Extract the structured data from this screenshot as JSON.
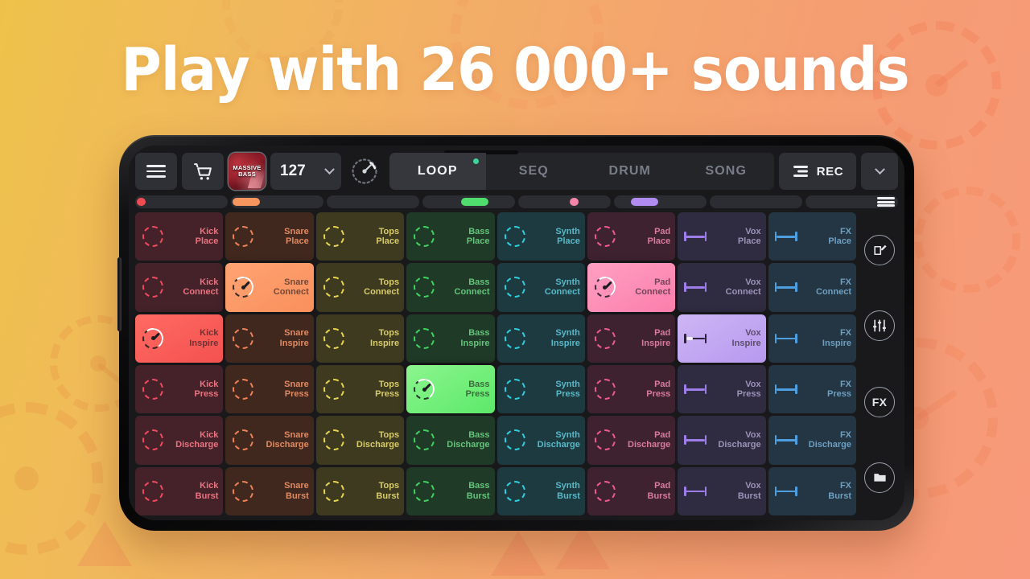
{
  "headline": "Play with 26 000+ sounds",
  "toolbar": {
    "menu_icon": "hamburger-menu-icon",
    "cart_icon": "shopping-cart-icon",
    "album_title": "MASSIVE\nBASS",
    "album_title_line1": "MASSIVE",
    "album_title_line2": "BASS",
    "bpm_value": "127",
    "bpm_chevron_icon": "chevron-down-icon",
    "knob_icon": "tempo-knob-icon",
    "rec_label": "REC",
    "rec_icon": "mixer-lines-icon",
    "expand_chevron_icon": "chevron-down-icon",
    "tabs": [
      {
        "label": "LOOP",
        "active": true,
        "dot": "#3ed39a"
      },
      {
        "label": "SEQ",
        "active": false,
        "dot": null
      },
      {
        "label": "DRUM",
        "active": false,
        "dot": null
      },
      {
        "label": "SONG",
        "active": false,
        "dot": null
      }
    ]
  },
  "trackbar": [
    {
      "marker": "dot",
      "color": "#ef4b52",
      "pos": 2
    },
    {
      "marker": "pill",
      "color": "#f7955e",
      "pos": 2
    },
    {
      "marker": "none",
      "color": null,
      "pos": 0
    },
    {
      "marker": "pill",
      "color": "#4fdd6e",
      "pos": 42
    },
    {
      "marker": "dot",
      "color": "#f285a8",
      "pos": 56
    },
    {
      "marker": "pill",
      "color": "#b18cf0",
      "pos": 18
    },
    {
      "marker": "none",
      "color": null,
      "pos": 0
    },
    {
      "marker": "lines",
      "color": "#f0f1f4",
      "pos": 0
    }
  ],
  "grid": {
    "columns": [
      {
        "name": "Kick",
        "accent": "#ef4b5e",
        "pad_bg": "#45222a",
        "text": "#e9737f",
        "active_bg": "linear-gradient(150deg,#ff6b63,#f4514f)",
        "active_text": "#7a1d23"
      },
      {
        "name": "Snare",
        "accent": "#f08057",
        "pad_bg": "#40281f",
        "text": "#e08a62",
        "active_bg": "linear-gradient(150deg,#ffa473,#f98f5c)",
        "active_text": "#7d3a1c"
      },
      {
        "name": "Tops",
        "accent": "#e8d451",
        "pad_bg": "#3d3a1f",
        "text": "#d8cb6b",
        "active_bg": "linear-gradient(150deg,#f4e677,#e8d451)",
        "active_text": "#6c6518"
      },
      {
        "name": "Bass",
        "accent": "#3fd45e",
        "pad_bg": "#1f3a27",
        "text": "#63c47a",
        "active_bg": "linear-gradient(150deg,#8cf58e,#5ce96a)",
        "active_text": "#1d6a2c"
      },
      {
        "name": "Synth",
        "accent": "#30cfe0",
        "pad_bg": "#1d3a40",
        "text": "#57b9c8",
        "active_bg": "linear-gradient(150deg,#7ae7f2,#44d3e2)",
        "active_text": "#13565f"
      },
      {
        "name": "Pad",
        "accent": "#ef5c8c",
        "pad_bg": "#3f2230",
        "text": "#d87a9a",
        "active_bg": "linear-gradient(150deg,#ffa0c2,#fb7eab)",
        "active_text": "#7d2murky"
      },
      {
        "name": "Vox",
        "accent": "#9d7ee8",
        "pad_bg": "#2f2b40",
        "text": "#9b93b8",
        "active_bg": "linear-gradient(150deg,#cdb6f5,#b799ef)",
        "active_text": "#4a3580"
      },
      {
        "name": "FX",
        "accent": "#4d9fe0",
        "pad_bg": "#243543",
        "text": "#6d9fc0",
        "active_bg": "linear-gradient(150deg,#86c6f2,#5aa9e6)",
        "active_text": "#1c4f73"
      }
    ],
    "rows": [
      "Place",
      "Connect",
      "Inspire",
      "Press",
      "Discharge",
      "Burst"
    ],
    "icon_styles": [
      "ring",
      "ring",
      "ring",
      "ring",
      "ring",
      "ring",
      "bar",
      "bar"
    ],
    "active_cells": [
      {
        "row": 1,
        "col": 1
      },
      {
        "row": 1,
        "col": 5
      },
      {
        "row": 2,
        "col": 0
      },
      {
        "row": 2,
        "col": 6
      },
      {
        "row": 3,
        "col": 3
      }
    ]
  },
  "rail": [
    {
      "icon": "edit-pencil-icon",
      "label": ""
    },
    {
      "icon": "mixer-sliders-icon",
      "label": ""
    },
    {
      "icon": "fx-icon",
      "label": "FX"
    },
    {
      "icon": "folder-icon",
      "label": ""
    }
  ],
  "colors": {
    "bg_start": "#eec24a",
    "bg_end": "#f7997a",
    "screen_bg": "#19191c",
    "toolbar_btn": "#2e3036",
    "accent_green": "#3ed39a"
  }
}
